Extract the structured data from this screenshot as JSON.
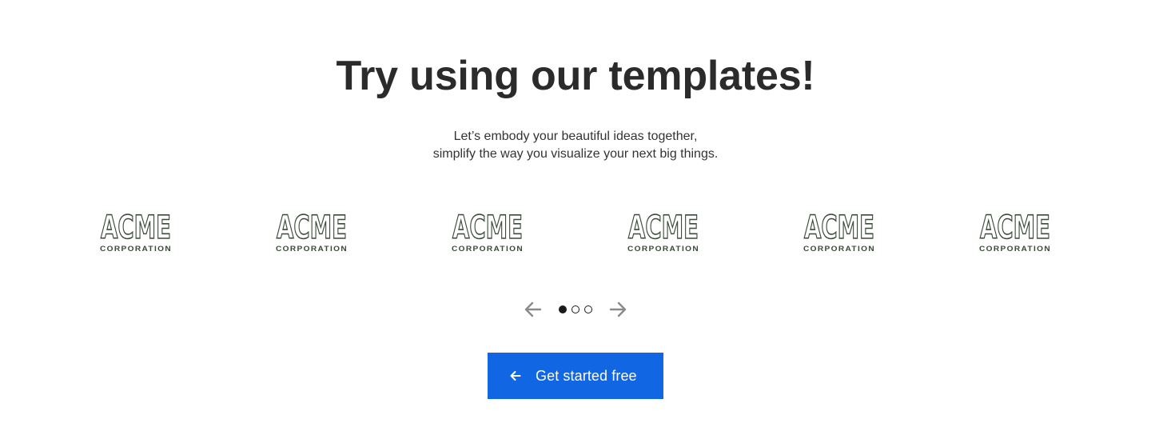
{
  "heading": {
    "title": "Try using our templates!",
    "subtitle_line1": "Let’s embody your beautiful ideas together,",
    "subtitle_line2": "simplify the way you visualize your next big things."
  },
  "logos": [
    {
      "wordmark": "ACME",
      "tagline": "CORPORATION"
    },
    {
      "wordmark": "ACME",
      "tagline": "CORPORATION"
    },
    {
      "wordmark": "ACME",
      "tagline": "CORPORATION"
    },
    {
      "wordmark": "ACME",
      "tagline": "CORPORATION"
    },
    {
      "wordmark": "ACME",
      "tagline": "CORPORATION"
    },
    {
      "wordmark": "ACME",
      "tagline": "CORPORATION"
    }
  ],
  "slider": {
    "prev_icon": "arrow-left-icon",
    "next_icon": "arrow-right-icon",
    "pages": 3,
    "active_page": 1
  },
  "cta": {
    "label": "Get started free",
    "icon": "arrow-left-icon"
  },
  "colors": {
    "logo_outline": "#3a4a38",
    "cta_background": "#1166e3",
    "heading_text": "#2b2b2b",
    "arrow": "#8a8a8a"
  }
}
